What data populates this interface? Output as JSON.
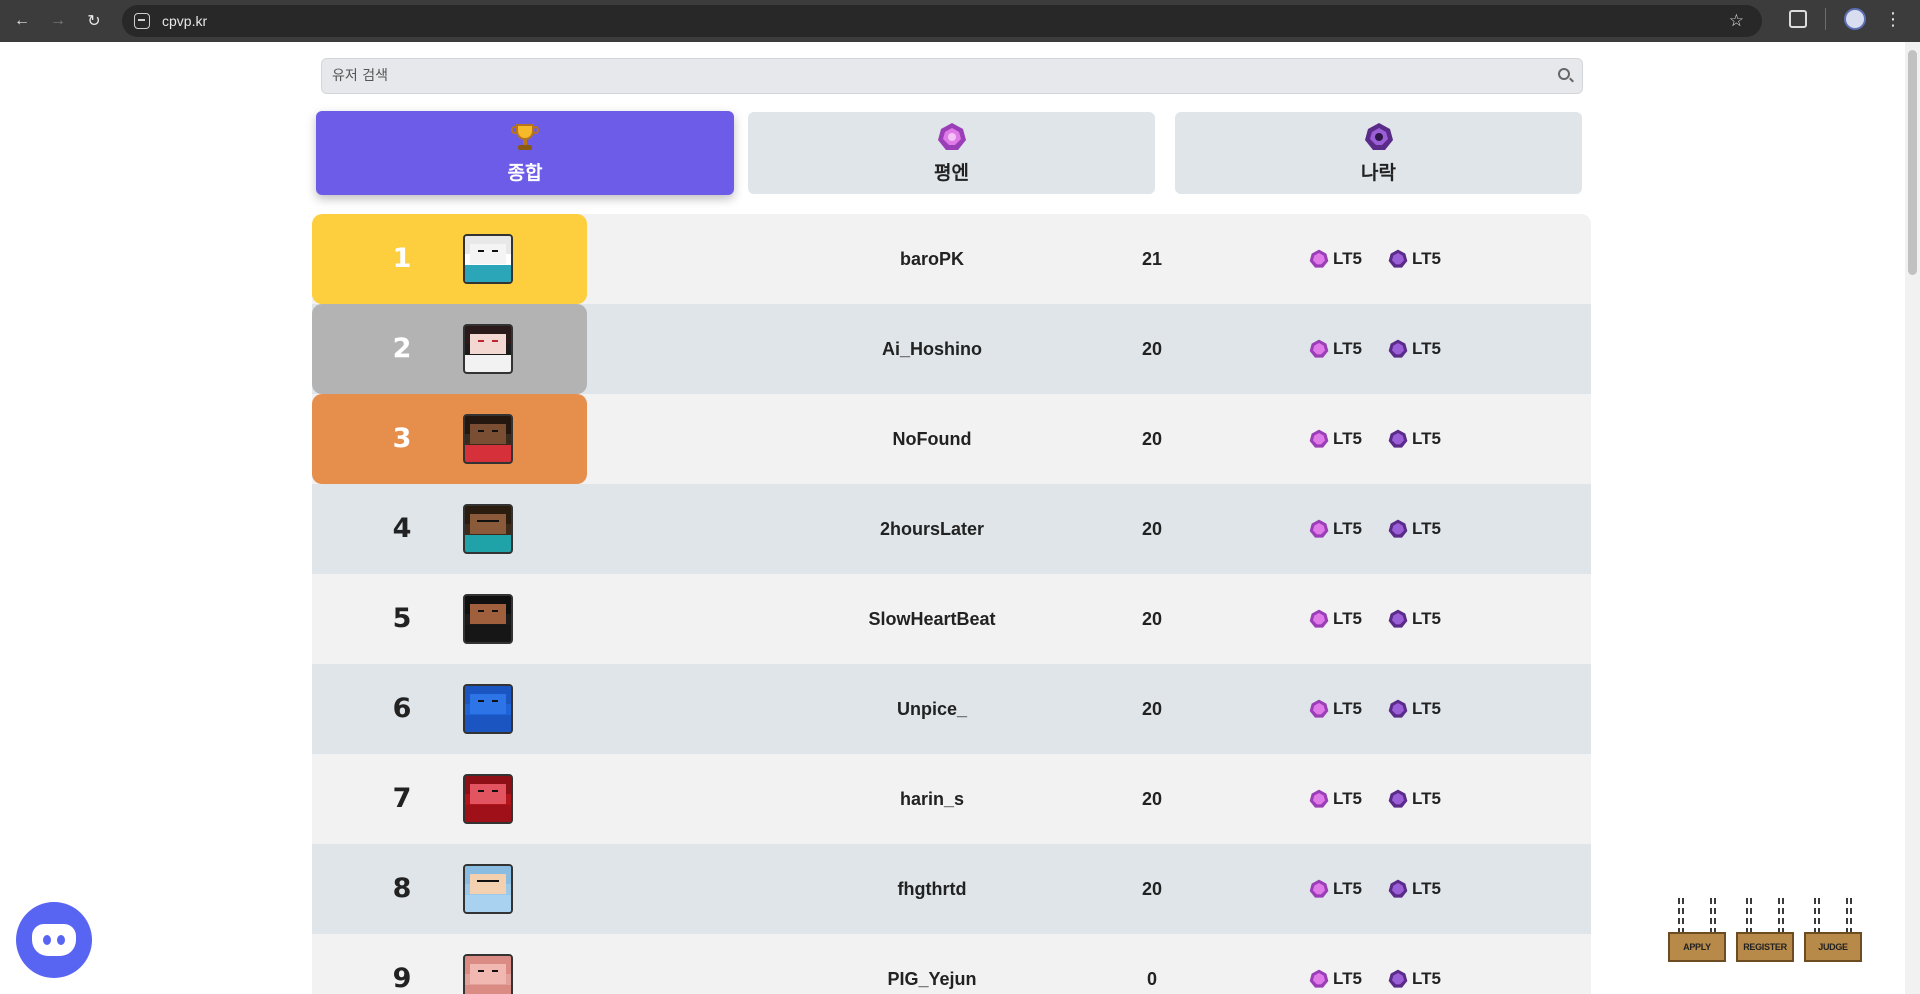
{
  "browser": {
    "url": "cpvp.kr"
  },
  "search": {
    "placeholder": "유저 검색"
  },
  "tabs": [
    {
      "label": "종합",
      "icon": "trophy-icon",
      "active": true
    },
    {
      "label": "평엔",
      "icon": "gem-icon",
      "active": false
    },
    {
      "label": "나락",
      "icon": "dark-gem-icon",
      "active": false
    }
  ],
  "leaderboard": {
    "rows": [
      {
        "rank": "1",
        "name": "baroPK",
        "score": "21",
        "tier1": "LT5",
        "tier2": "LT5"
      },
      {
        "rank": "2",
        "name": "Ai_Hoshino",
        "score": "20",
        "tier1": "LT5",
        "tier2": "LT5"
      },
      {
        "rank": "3",
        "name": "NoFound",
        "score": "20",
        "tier1": "LT5",
        "tier2": "LT5"
      },
      {
        "rank": "4",
        "name": "2hoursLater",
        "score": "20",
        "tier1": "LT5",
        "tier2": "LT5"
      },
      {
        "rank": "5",
        "name": "SlowHeartBeat",
        "score": "20",
        "tier1": "LT5",
        "tier2": "LT5"
      },
      {
        "rank": "6",
        "name": "Unpice_",
        "score": "20",
        "tier1": "LT5",
        "tier2": "LT5"
      },
      {
        "rank": "7",
        "name": "harin_s",
        "score": "20",
        "tier1": "LT5",
        "tier2": "LT5"
      },
      {
        "rank": "8",
        "name": "fhgthrtd",
        "score": "20",
        "tier1": "LT5",
        "tier2": "LT5"
      },
      {
        "rank": "9",
        "name": "PIG_Yejun",
        "score": "0",
        "tier1": "LT5",
        "tier2": "LT5"
      }
    ]
  },
  "signs": [
    {
      "label": "APPLY"
    },
    {
      "label": "REGISTER"
    },
    {
      "label": "JUDGE"
    }
  ],
  "colors": {
    "accent": "#6c5ce7",
    "gold": "#fdcf3f",
    "silver": "#b3b3b3",
    "bronze": "#e68f4d",
    "discord": "#5865f2"
  }
}
